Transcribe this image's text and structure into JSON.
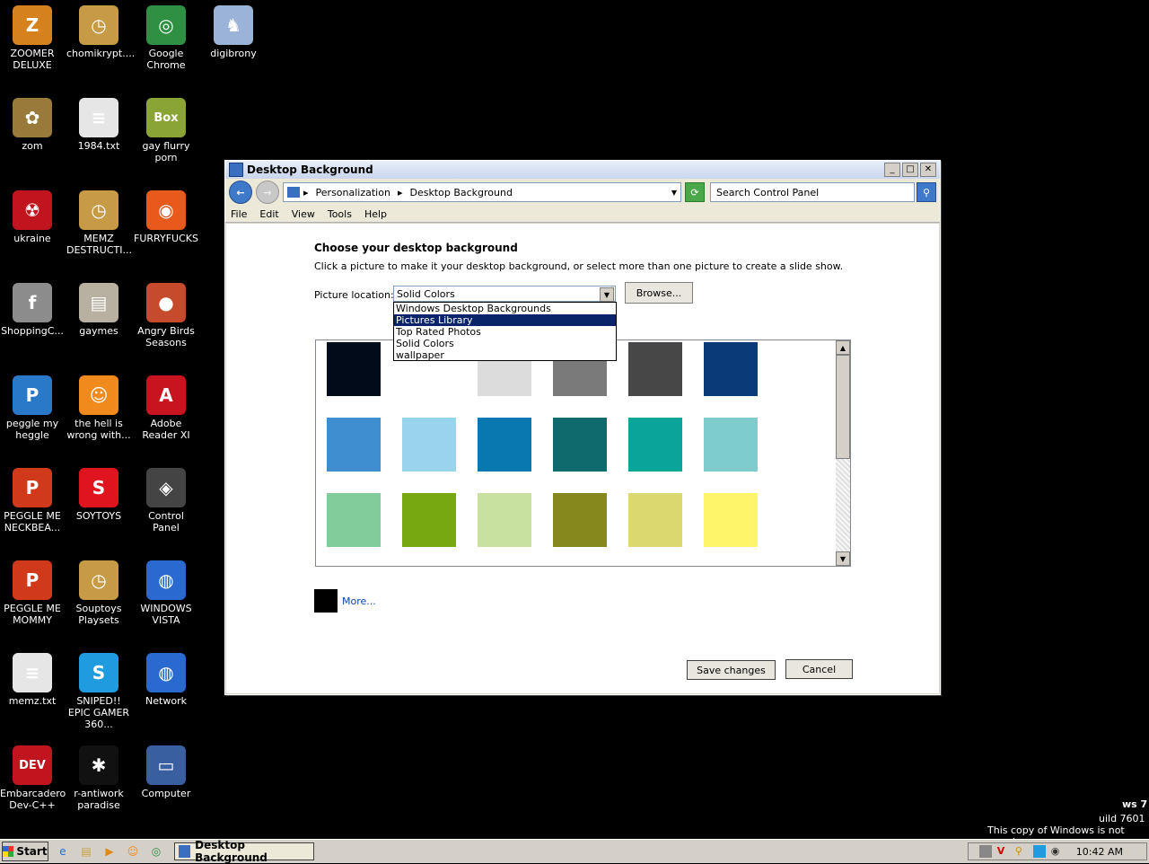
{
  "desktop": {
    "icons": [
      {
        "label": "ZOOMER DELUXE",
        "icon": "zoomer-icon",
        "color": "#d4811e",
        "glyph": "Z"
      },
      {
        "label": "chomikrypt....",
        "icon": "clock-icon",
        "color": "#c79a45",
        "glyph": "◷"
      },
      {
        "label": "Google Chrome",
        "icon": "chrome-icon",
        "color": "#2f8f42",
        "glyph": "◎"
      },
      {
        "label": "digibrony",
        "icon": "digibrony-icon",
        "color": "#9ab3d6",
        "glyph": "♞"
      },
      {
        "label": "zom",
        "icon": "flower-icon",
        "color": "#9a7a3a",
        "glyph": "✿"
      },
      {
        "label": "1984.txt",
        "icon": "text-file-icon",
        "color": "#e6e6e6",
        "glyph": "≡"
      },
      {
        "label": "gay flurry porn",
        "icon": "box-icon",
        "color": "#8aa536",
        "glyph": "Box"
      },
      {
        "label": "ukraine",
        "icon": "radiation-icon",
        "color": "#c0141e",
        "glyph": "☢"
      },
      {
        "label": "MEMZ DESTRUCTI...",
        "icon": "clock-icon",
        "color": "#c79a45",
        "glyph": "◷"
      },
      {
        "label": "FURRYFUCKS",
        "icon": "firefox-icon",
        "color": "#e85a1c",
        "glyph": "◉"
      },
      {
        "label": "ShoppingC...",
        "icon": "flash-icon",
        "color": "#8c8c8c",
        "glyph": "f"
      },
      {
        "label": "gaymes",
        "icon": "folder-icon",
        "color": "#b8b0a0",
        "glyph": "▤"
      },
      {
        "label": "Angry Birds Seasons",
        "icon": "angry-birds-icon",
        "color": "#c64b2c",
        "glyph": "●"
      },
      {
        "label": "peggle my heggle",
        "icon": "peggle-icon",
        "color": "#2a78c8",
        "glyph": "P"
      },
      {
        "label": "the hell is wrong with...",
        "icon": "uc-browser-icon",
        "color": "#f08a1c",
        "glyph": "☺"
      },
      {
        "label": "Adobe Reader XI",
        "icon": "adobe-reader-icon",
        "color": "#c8141e",
        "glyph": "A"
      },
      {
        "label": "PEGGLE ME NECKBEA...",
        "icon": "peggle-icon",
        "color": "#d03a1a",
        "glyph": "P"
      },
      {
        "label": "SOYTOYS",
        "icon": "soytoys-icon",
        "color": "#e0141e",
        "glyph": "S"
      },
      {
        "label": "Control Panel",
        "icon": "control-panel-icon",
        "color": "#444",
        "glyph": "◈"
      },
      {
        "label": "PEGGLE ME MOMMY",
        "icon": "peggle-icon",
        "color": "#d03a1a",
        "glyph": "P"
      },
      {
        "label": "Souptoys Playsets",
        "icon": "clock-icon",
        "color": "#c79a45",
        "glyph": "◷"
      },
      {
        "label": "WINDOWS VISTA",
        "icon": "globe-icon",
        "color": "#2a6ad0",
        "glyph": "◍"
      },
      {
        "label": "memz.txt",
        "icon": "text-file-icon",
        "color": "#e6e6e6",
        "glyph": "≡"
      },
      {
        "label": "SNIPED!! EPIC GAMER 360...",
        "icon": "skype-icon",
        "color": "#1f9ce0",
        "glyph": "S"
      },
      {
        "label": "Network",
        "icon": "network-icon",
        "color": "#2a6ad0",
        "glyph": "◍"
      },
      {
        "label": "Embarcadero Dev-C++",
        "icon": "devcpp-icon",
        "color": "#c0141e",
        "glyph": "DEV"
      },
      {
        "label": "r-antiwork paradise",
        "icon": "antiwork-icon",
        "color": "#111",
        "glyph": "✱"
      },
      {
        "label": "Computer",
        "icon": "computer-icon",
        "color": "#3a5fa0",
        "glyph": "▭"
      }
    ]
  },
  "window": {
    "title": "Desktop Background",
    "breadcrumb": [
      "Personalization",
      "Desktop Background"
    ],
    "search_placeholder": "Search Control Panel",
    "menu": [
      "File",
      "Edit",
      "View",
      "Tools",
      "Help"
    ],
    "heading": "Choose your desktop background",
    "subtext": "Click a picture to make it your desktop background, or select more than one picture to create a slide show.",
    "location_label": "Picture location:",
    "location_value": "Solid Colors",
    "browse_label": "Browse...",
    "dropdown_options": [
      "Windows Desktop Backgrounds",
      "Pictures Library",
      "Top Rated Photos",
      "Solid Colors",
      "wallpaper"
    ],
    "dropdown_selected_index": 1,
    "swatch_rows": [
      [
        "#020b1a",
        "#ffffff",
        "#dcdcdc",
        "#7a7a7a",
        "#474747",
        "#0b3a78"
      ],
      [
        "#3f8ed0",
        "#98d4eb",
        "#0a78b0",
        "#0f6a6e",
        "#0aa59a",
        "#7ecccb"
      ],
      [
        "#82cc9c",
        "#78a810",
        "#c8e0a0",
        "#86881e",
        "#dcd870",
        "#fff56a"
      ]
    ],
    "more_label": "More...",
    "save_label": "Save changes",
    "cancel_label": "Cancel"
  },
  "taskbar": {
    "start_label": "Start",
    "active_task": "Desktop Background",
    "clock": "10:42 AM"
  },
  "watermark": {
    "line1": "ws 7",
    "line2": "uild 7601",
    "line3": "This copy of Windows is not genuine"
  }
}
